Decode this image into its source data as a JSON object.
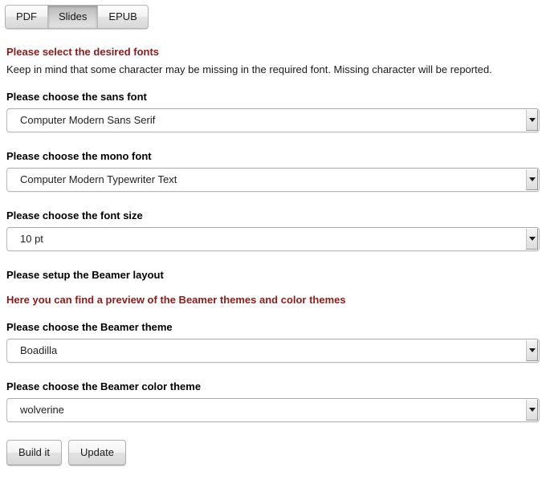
{
  "tabs": [
    {
      "label": "PDF",
      "active": false
    },
    {
      "label": "Slides",
      "active": true
    },
    {
      "label": "EPUB",
      "active": false
    }
  ],
  "fonts_section": {
    "heading": "Please select the desired fonts",
    "description": "Keep in mind that some character may be missing in the required font. Missing character will be reported.",
    "sans": {
      "label": "Please choose the sans font",
      "value": "Computer Modern Sans Serif"
    },
    "mono": {
      "label": "Please choose the mono font",
      "value": "Computer Modern Typewriter Text"
    },
    "size": {
      "label": "Please choose the font size",
      "value": "10 pt"
    }
  },
  "beamer_section": {
    "heading": "Please setup the Beamer layout",
    "preview_link": "Here you can find a preview of the Beamer themes and color themes",
    "theme": {
      "label": "Please choose the Beamer theme",
      "value": "Boadilla"
    },
    "color_theme": {
      "label": "Please choose the Beamer color theme",
      "value": "wolverine"
    }
  },
  "actions": {
    "build_label": "Build it",
    "update_label": "Update"
  },
  "colors": {
    "accent_red": "#8b1a1a",
    "text": "#1a1a1a",
    "tab_active_bg": "#c9c9c9"
  },
  "icons": {
    "dropdown": "chevron-down-icon"
  }
}
